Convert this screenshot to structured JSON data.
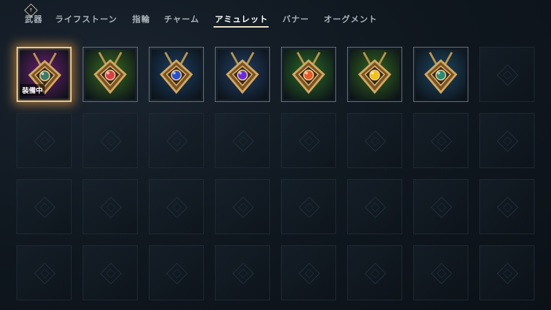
{
  "tabs": {
    "key_hint": "↑",
    "items": [
      {
        "label": "武器"
      },
      {
        "label": "ライフストーン"
      },
      {
        "label": "指輪"
      },
      {
        "label": "チャーム"
      },
      {
        "label": "アミュレット"
      },
      {
        "label": "バナー"
      },
      {
        "label": "オーグメント"
      }
    ],
    "active_index": 4
  },
  "inventory": {
    "equipped_label": "装備中",
    "items": [
      {
        "icon": "amulet-purple-frame-icon",
        "bg": "#6a1f6e",
        "gem": "#3d7a6a",
        "equipped": true
      },
      {
        "icon": "amulet-red-gem-icon",
        "bg": "#3a6b22",
        "gem": "#d8404a",
        "equipped": false
      },
      {
        "icon": "amulet-blue-gem-icon",
        "bg": "#1d3f63",
        "gem": "#2a4fd0",
        "equipped": false
      },
      {
        "icon": "amulet-violet-gem-icon",
        "bg": "#233f66",
        "gem": "#6a2cd8",
        "equipped": false
      },
      {
        "icon": "amulet-round-orange-icon",
        "bg": "#2b6b27",
        "gem": "#e85a2a",
        "equipped": false
      },
      {
        "icon": "amulet-sun-yellow-icon",
        "bg": "#33661f",
        "gem": "#f0c21a",
        "equipped": false
      },
      {
        "icon": "amulet-green-stone-icon",
        "bg": "#1f4763",
        "gem": "#2c8a72",
        "equipped": false
      }
    ]
  }
}
